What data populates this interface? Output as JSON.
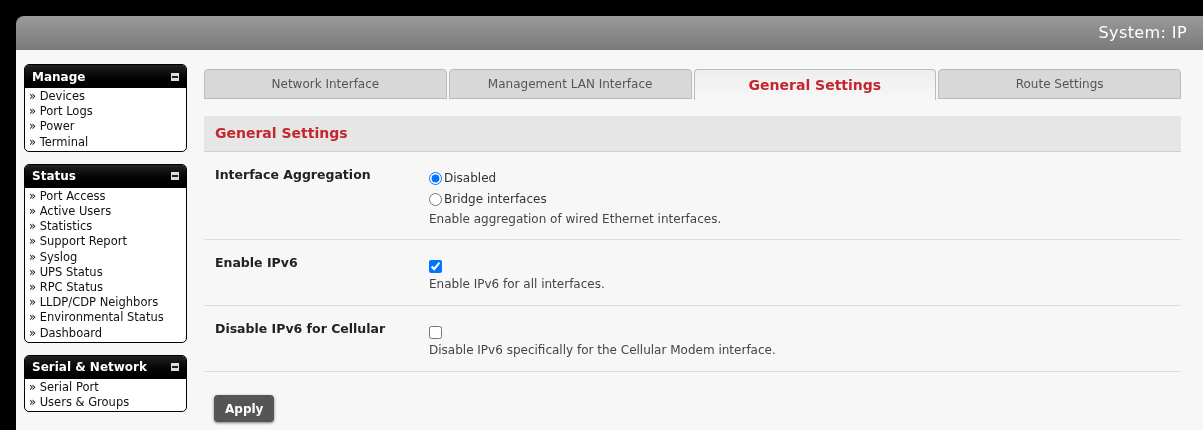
{
  "header": {
    "title": "System: IP"
  },
  "sidebar": [
    {
      "title": "Manage",
      "items": [
        "» Devices",
        "» Port Logs",
        "» Power",
        "» Terminal"
      ]
    },
    {
      "title": "Status",
      "items": [
        "» Port Access",
        "» Active Users",
        "» Statistics",
        "» Support Report",
        "» Syslog",
        "» UPS Status",
        "» RPC Status",
        "» LLDP/CDP Neighbors",
        "» Environmental Status",
        "» Dashboard"
      ]
    },
    {
      "title": "Serial & Network",
      "items": [
        "» Serial Port",
        "» Users & Groups"
      ]
    }
  ],
  "tabs": [
    {
      "label": "Network Interface",
      "selected": false
    },
    {
      "label": "Management LAN Interface",
      "selected": false
    },
    {
      "label": "General Settings",
      "selected": true
    },
    {
      "label": "Route Settings",
      "selected": false
    }
  ],
  "section": {
    "title": "General Settings"
  },
  "settings": [
    {
      "label": "Interface Aggregation",
      "kind": "radio",
      "options": [
        {
          "label": "Disabled",
          "selected": true
        },
        {
          "label": "Bridge interfaces",
          "selected": false
        }
      ],
      "help": "Enable aggregation of wired Ethernet interfaces."
    },
    {
      "label": "Enable IPv6",
      "kind": "checkbox",
      "checked": true,
      "help": "Enable IPv6 for all interfaces."
    },
    {
      "label": "Disable IPv6 for Cellular",
      "kind": "checkbox",
      "checked": false,
      "help": "Disable IPv6 specifically for the Cellular Modem interface."
    }
  ],
  "apply_button": "Apply"
}
